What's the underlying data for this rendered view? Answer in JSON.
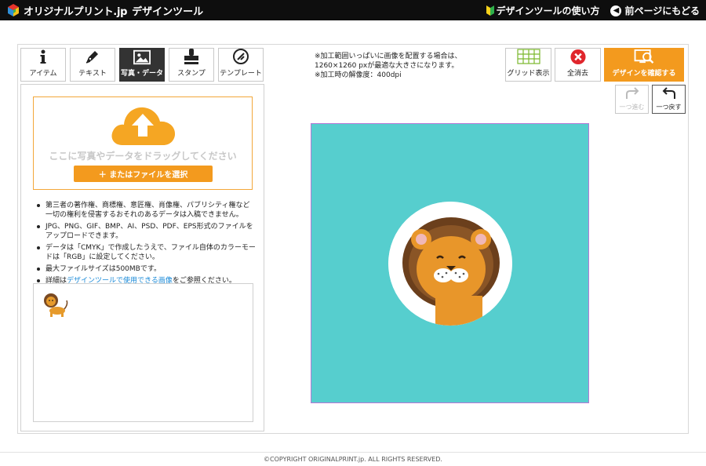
{
  "header": {
    "logo_text": "オリジナルプリント.jp",
    "logo_sub": "デザインツール",
    "guide_link": "デザインツールの使い方",
    "back_link": "前ページにもどる"
  },
  "tabs": [
    {
      "label": "アイテム",
      "icon": "info-icon",
      "active": false
    },
    {
      "label": "テキスト",
      "icon": "pen-icon",
      "active": false
    },
    {
      "label": "写真・データ",
      "icon": "image-icon",
      "active": true
    },
    {
      "label": "スタンプ",
      "icon": "stamp-icon",
      "active": false
    },
    {
      "label": "テンプレート",
      "icon": "template-icon",
      "active": false
    }
  ],
  "upload": {
    "drop_text": "ここに写真やデータをドラッグしてください",
    "select_button": "＋ またはファイルを選択"
  },
  "notes": {
    "n1": "第三者の著作権、商標権、意匠権、肖像権、パブリシティ権など一切の権利を侵害するおそれのあるデータは入稿できません。",
    "n2": "JPG、PNG、GIF、BMP、AI、PSD、PDF、EPS形式のファイルをアップロードできます。",
    "n3": "データは「CMYK」で作成したうえで、ファイル自体のカラーモードは「RGB」に設定してください。",
    "n4": "最大ファイルサイズは500MBです。",
    "n5_prefix": "詳細は",
    "n5_link": "デザインツールで使用できる画像",
    "n5_suffix": "をご参照ください。"
  },
  "info": {
    "line1": "※加工範囲いっぱいに画像を配置する場合は、",
    "line2": "1260×1260 pxが最適な大きさになります。",
    "line3": "※加工時の解像度：400dpi"
  },
  "toolbar": {
    "grid_label": "グリッド表示",
    "clear_label": "全消去",
    "confirm_label": "デザインを確認する",
    "redo_label": "一つ進む",
    "undo_label": "一つ戻す"
  },
  "colors": {
    "accent_orange": "#f39a1e",
    "canvas_bg": "#56cece",
    "canvas_border": "#b678d6",
    "link_blue": "#1a8ad8"
  },
  "footer": {
    "copyright": "©COPYRIGHT ORIGINALPRINT.jp. ALL RIGHTS RESERVED."
  }
}
